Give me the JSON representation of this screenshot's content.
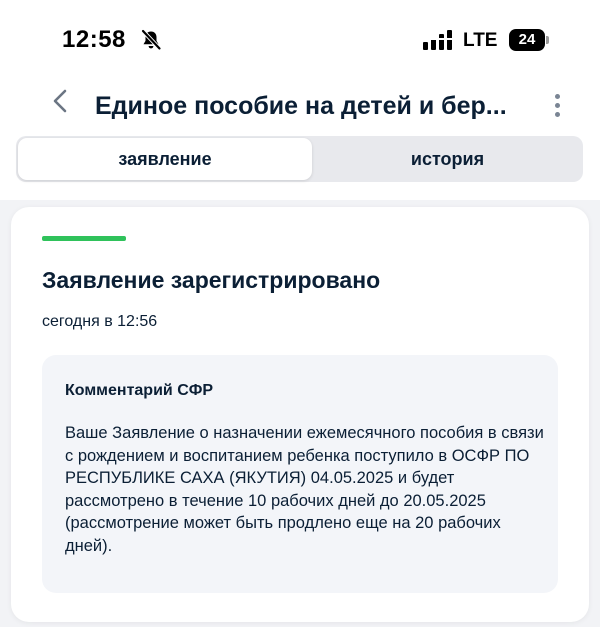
{
  "status_bar": {
    "time": "12:58",
    "network": "LTE",
    "battery": "24",
    "icons": [
      "bell-muted-icon",
      "signal-icon",
      "battery-icon"
    ]
  },
  "header": {
    "title": "Единое пособие на детей и бер...",
    "icons": [
      "chevron-left-icon",
      "more-vertical-icon"
    ]
  },
  "tabs": [
    {
      "label": "заявление",
      "active": true
    },
    {
      "label": "история",
      "active": false
    }
  ],
  "card": {
    "status_title": "Заявление зарегистрировано",
    "status_time": "сегодня в 12:56",
    "status_color": "#2fc25b",
    "comment": {
      "title": "Комментарий СФР",
      "text": "Ваше Заявление о назначении ежемесячного пособия в связи с рождением и воспитанием ребенка поступило в ОСФР ПО РЕСПУБЛИКЕ САХА (ЯКУТИЯ) 04.05.2025 и будет рассмотрено в течение 10 рабочих дней до 20.05.2025 (рассмотрение может быть продлено еще на 20 рабочих дней)."
    }
  }
}
